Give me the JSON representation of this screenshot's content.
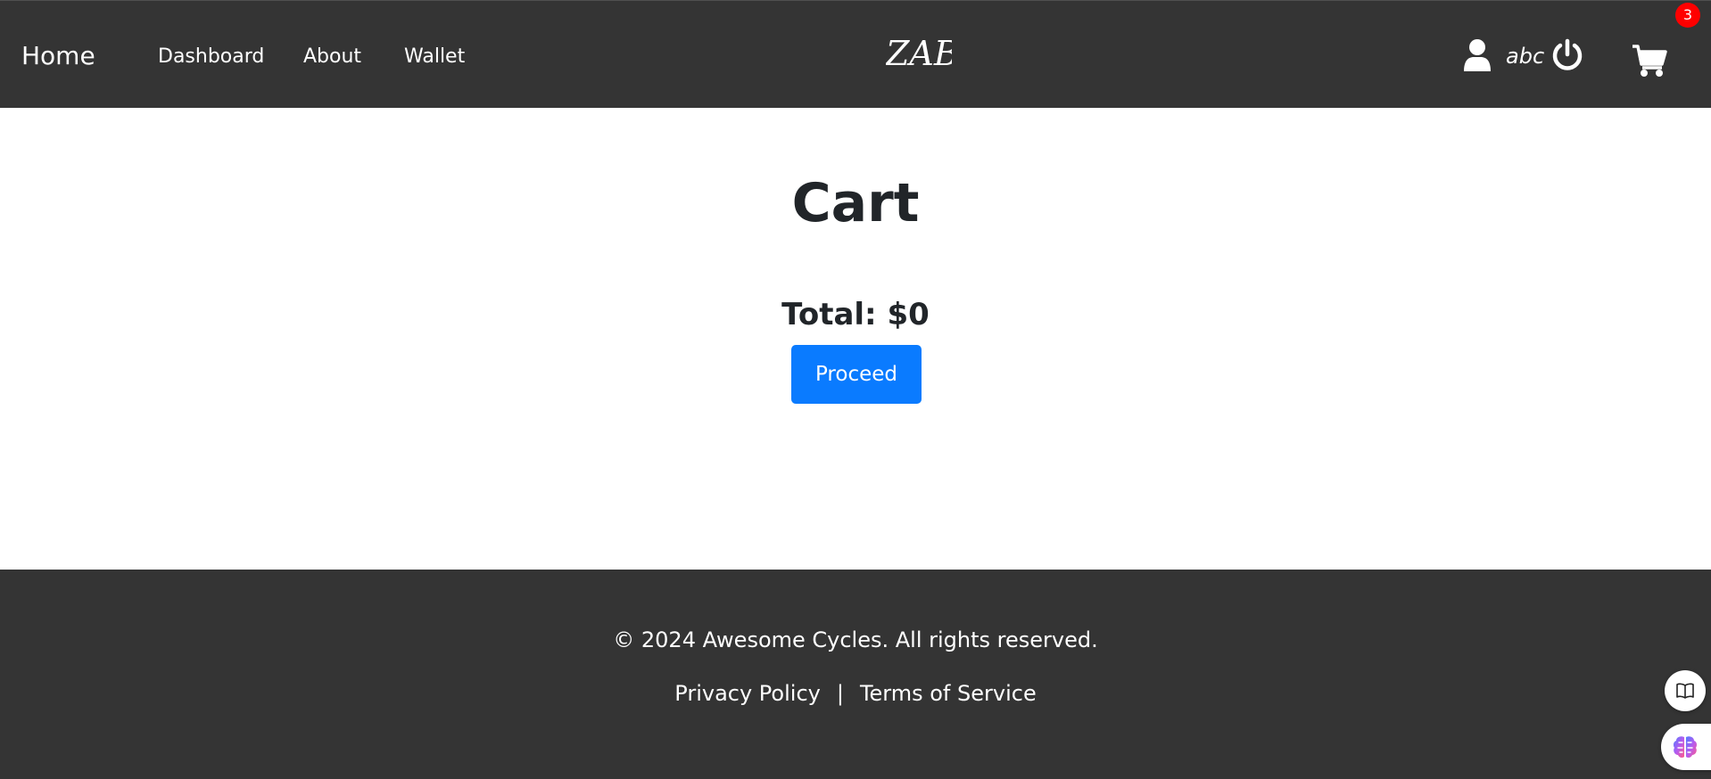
{
  "header": {
    "home_label": "Home",
    "nav": {
      "dashboard": "Dashboard",
      "about": "About",
      "wallet": "Wallet"
    },
    "logo_icon": "brand-monogram-logo",
    "username": "abc",
    "cart_count": "3",
    "user_icon": "user-icon",
    "power_icon": "power-icon",
    "cart_icon": "shopping-cart-icon"
  },
  "main": {
    "title": "Cart",
    "total_text": "Total: $0",
    "proceed_label": "Proceed"
  },
  "footer": {
    "copyright": "© 2024 Awesome Cycles. All rights reserved.",
    "privacy_label": "Privacy Policy",
    "separator": "|",
    "terms_label": "Terms of Service"
  },
  "widgets": {
    "reader_icon": "book-open-icon",
    "assistant_icon": "brain-icon"
  },
  "colors": {
    "navbar_bg": "#343434",
    "primary_button": "#0a7bff",
    "badge": "#ff0000",
    "text_dark": "#212529"
  }
}
